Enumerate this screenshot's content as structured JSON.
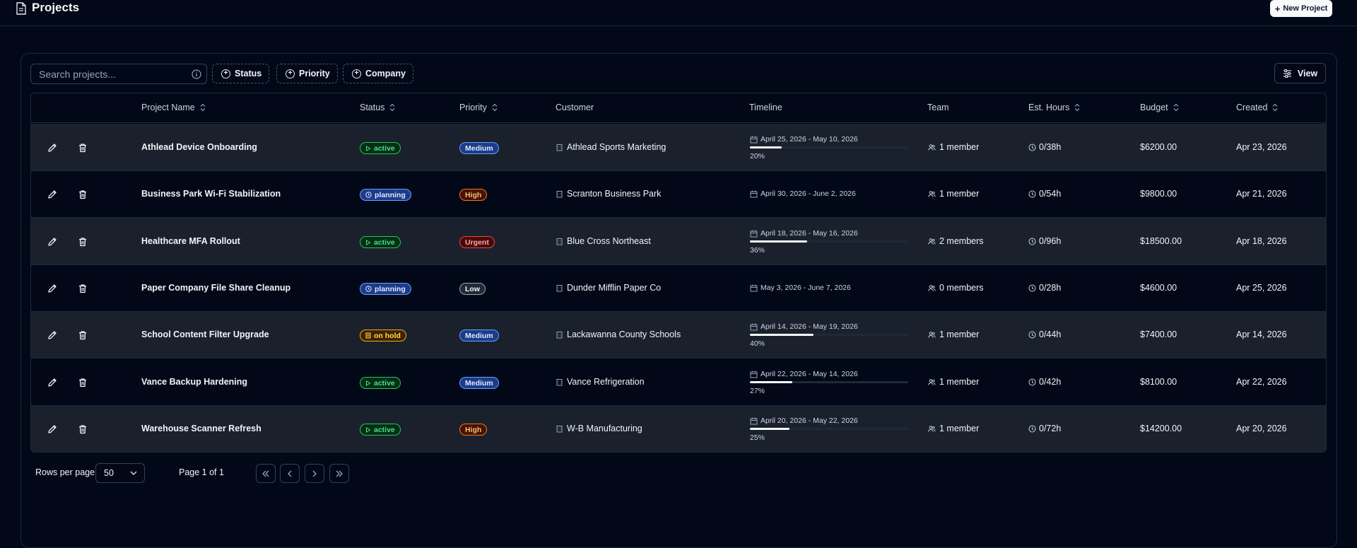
{
  "header": {
    "title": "Projects",
    "new_button_label": "New Project"
  },
  "toolbar": {
    "search_placeholder": "Search projects...",
    "filters": [
      "Status",
      "Priority",
      "Company"
    ],
    "view_label": "View"
  },
  "table": {
    "columns": [
      "Project Name",
      "Status",
      "Priority",
      "Customer",
      "Timeline",
      "Team",
      "Est. Hours",
      "Budget",
      "Created"
    ],
    "rows": [
      {
        "name": "Athlead Device Onboarding",
        "status": "active",
        "priority": "Medium",
        "customer": "Athlead Sports Marketing",
        "timeline": "April 25, 2026 - May 10, 2026",
        "progress": "20%",
        "progress_value": 20,
        "team": "1 member",
        "hours": "0/38h",
        "budget": "$6200.00",
        "created": "Apr 23, 2026"
      },
      {
        "name": "Business Park Wi-Fi Stabilization",
        "status": "planning",
        "priority": "High",
        "customer": "Scranton Business Park",
        "timeline": "April 30, 2026 - June 2, 2026",
        "progress": "",
        "progress_value": null,
        "team": "1 member",
        "hours": "0/54h",
        "budget": "$9800.00",
        "created": "Apr 21, 2026"
      },
      {
        "name": "Healthcare MFA Rollout",
        "status": "active",
        "priority": "Urgent",
        "customer": "Blue Cross Northeast",
        "timeline": "April 18, 2026 - May 16, 2026",
        "progress": "36%",
        "progress_value": 36,
        "team": "2 members",
        "hours": "0/96h",
        "budget": "$18500.00",
        "created": "Apr 18, 2026"
      },
      {
        "name": "Paper Company File Share Cleanup",
        "status": "planning",
        "priority": "Low",
        "customer": "Dunder Mifflin Paper Co",
        "timeline": "May 3, 2026 - June 7, 2026",
        "progress": "",
        "progress_value": null,
        "team": "0 members",
        "hours": "0/28h",
        "budget": "$4600.00",
        "created": "Apr 25, 2026"
      },
      {
        "name": "School Content Filter Upgrade",
        "status": "on hold",
        "priority": "Medium",
        "customer": "Lackawanna County Schools",
        "timeline": "April 14, 2026 - May 19, 2026",
        "progress": "40%",
        "progress_value": 40,
        "team": "1 member",
        "hours": "0/44h",
        "budget": "$7400.00",
        "created": "Apr 14, 2026"
      },
      {
        "name": "Vance Backup Hardening",
        "status": "active",
        "priority": "Medium",
        "customer": "Vance Refrigeration",
        "timeline": "April 22, 2026 - May 14, 2026",
        "progress": "27%",
        "progress_value": 27,
        "team": "1 member",
        "hours": "0/42h",
        "budget": "$8100.00",
        "created": "Apr 22, 2026"
      },
      {
        "name": "Warehouse Scanner Refresh",
        "status": "active",
        "priority": "High",
        "customer": "W-B Manufacturing",
        "timeline": "April 20, 2026 - May 22, 2026",
        "progress": "25%",
        "progress_value": 25,
        "team": "1 member",
        "hours": "0/72h",
        "budget": "$14200.00",
        "created": "Apr 20, 2026"
      }
    ]
  },
  "footer": {
    "rows_per_page_label": "Rows per page",
    "rows_per_page": "50",
    "page_info": "Page 1 of 1"
  },
  "colors": {
    "background": "#020817",
    "border": "#1e293b",
    "row_shaded": "#1a212c"
  }
}
